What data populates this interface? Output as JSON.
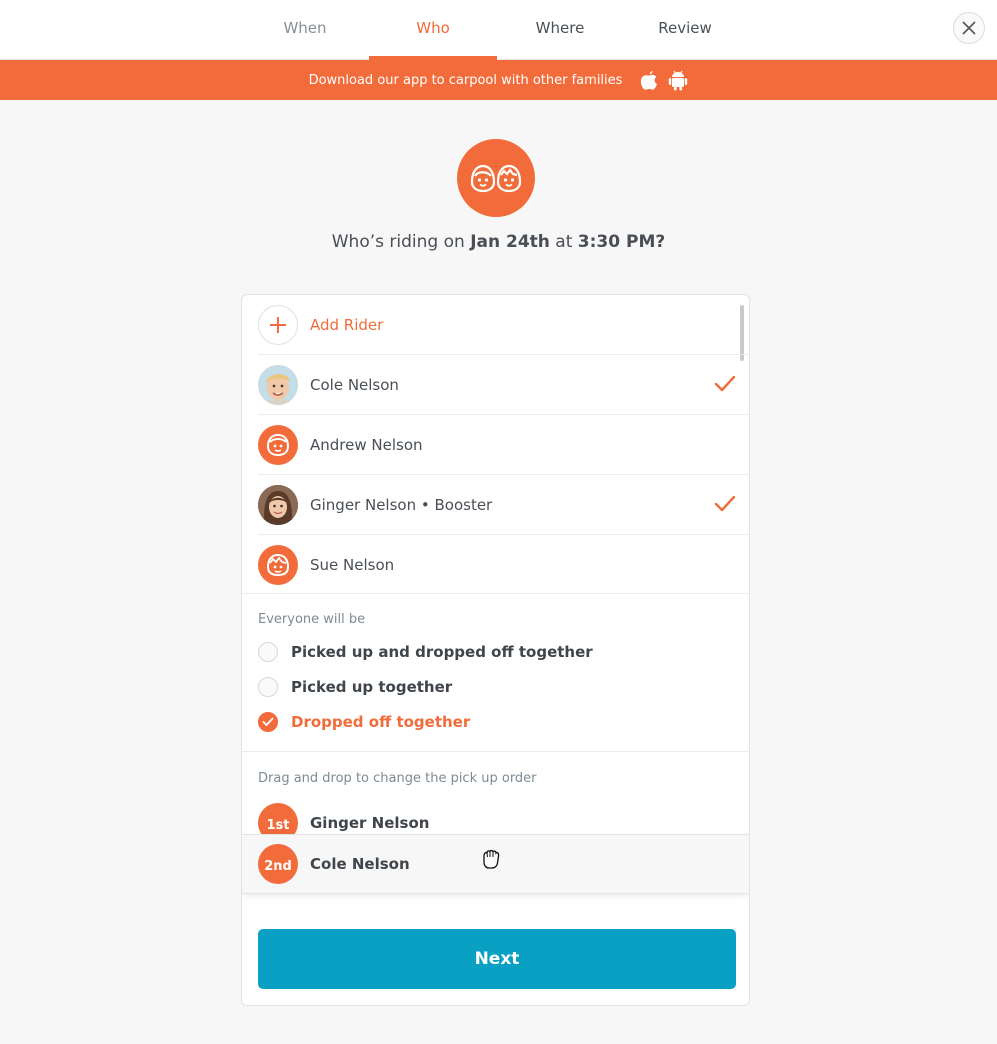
{
  "tabs": [
    {
      "label": "When",
      "state": "done"
    },
    {
      "label": "Who",
      "state": "active"
    },
    {
      "label": "Where",
      "state": "normal"
    },
    {
      "label": "Review",
      "state": "normal"
    }
  ],
  "banner": {
    "text": "Download our app to carpool with other families",
    "icons": [
      "apple-icon",
      "android-icon"
    ]
  },
  "question": {
    "prefix": "Who’s riding on ",
    "date": "Jan 24th",
    "middle": " at ",
    "time": "3:30 PM?"
  },
  "riders": {
    "add_label": "Add Rider",
    "items": [
      {
        "name": "Cole Nelson",
        "checked": true,
        "avatar": "photo-boy"
      },
      {
        "name": "Andrew Nelson",
        "checked": false,
        "avatar": "placeholder-boy"
      },
      {
        "name": "Ginger Nelson • Booster",
        "checked": true,
        "avatar": "photo-girl"
      },
      {
        "name": "Sue Nelson",
        "checked": false,
        "avatar": "placeholder-girl"
      }
    ]
  },
  "grouping": {
    "label": "Everyone will be",
    "options": [
      {
        "label": "Picked up and dropped off together",
        "selected": false
      },
      {
        "label": "Picked up together",
        "selected": false
      },
      {
        "label": "Dropped off together",
        "selected": true
      }
    ]
  },
  "order": {
    "label": "Drag and drop to change the pick up order",
    "items": [
      {
        "badge": "1st",
        "name": "Ginger Nelson"
      },
      {
        "badge": "2nd",
        "name": "Cole Nelson"
      }
    ]
  },
  "next_label": "Next",
  "colors": {
    "accent": "#f26b3a",
    "button": "#0aa0c4"
  }
}
